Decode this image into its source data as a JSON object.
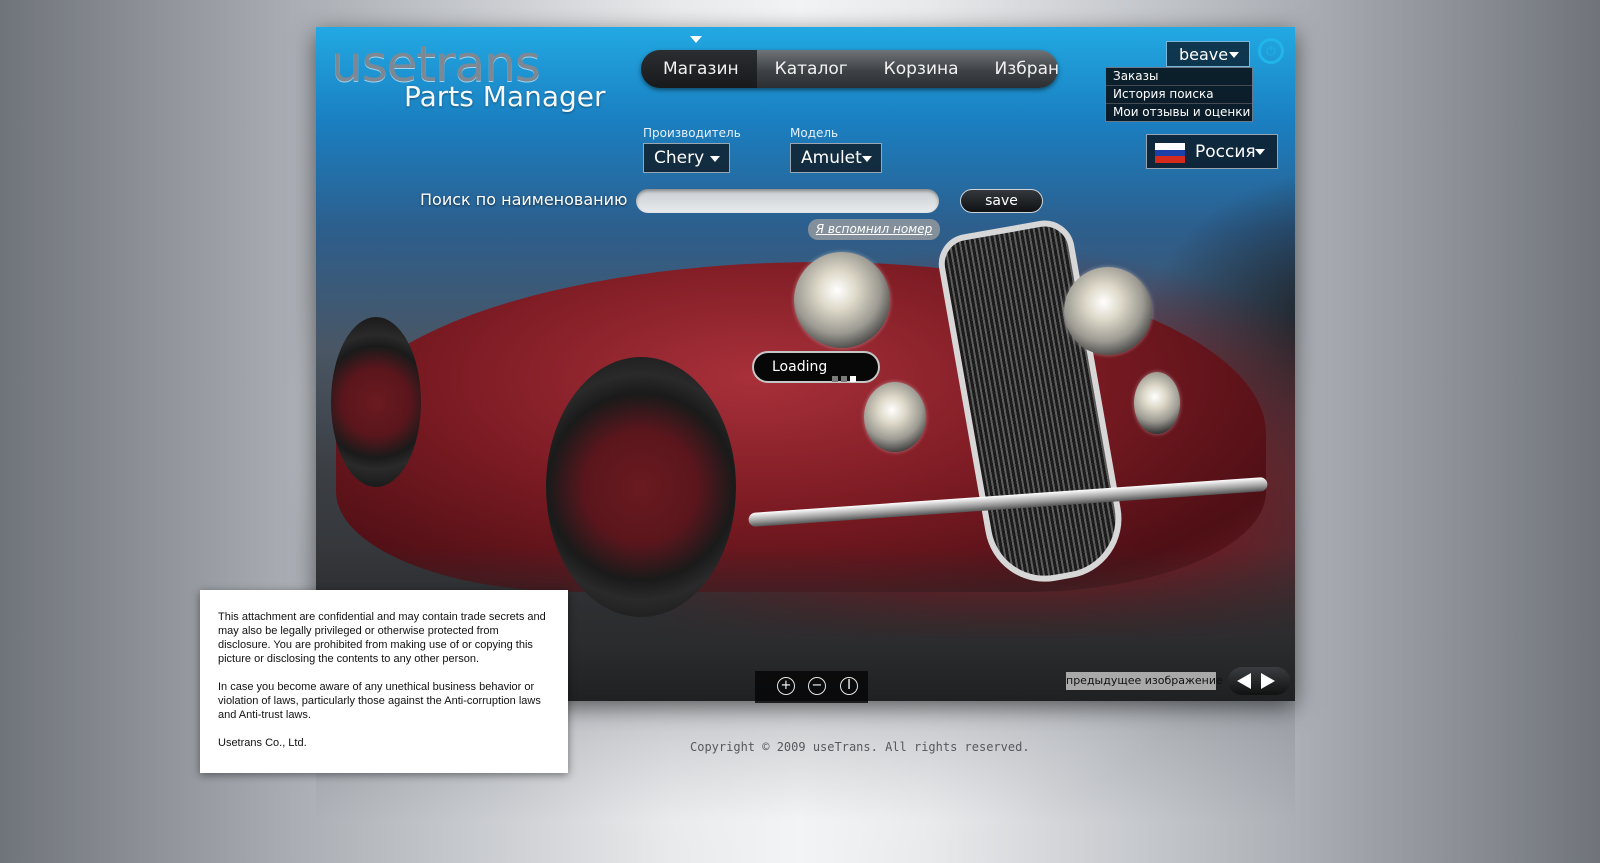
{
  "logo": {
    "brand": "usetrans",
    "subtitle": "Parts Manager"
  },
  "nav": {
    "tabs": [
      "Магазин",
      "Каталог",
      "Корзина",
      "Избранное"
    ],
    "active_index": 0
  },
  "user": {
    "name": "beave",
    "menu": [
      "Заказы",
      "История поиска",
      "Мои отзывы и оценки"
    ]
  },
  "country": {
    "label": "Россия",
    "flag_colors": [
      "#ffffff",
      "#1c3fa8",
      "#d52b1e"
    ]
  },
  "filters": {
    "manufacturer_label": "Производитель",
    "manufacturer_value": "Chery",
    "model_label": "Модель",
    "model_value": "Amulet"
  },
  "search": {
    "label": "Поиск по наименованию",
    "value": "",
    "save_label": "save",
    "remember_link": "Я вспомнил номер"
  },
  "loading": {
    "label": "Loading"
  },
  "zoom": {
    "icons": [
      "zoom-in-icon",
      "zoom-out-icon",
      "info-icon"
    ]
  },
  "gallery": {
    "prev_label": "предыдущее изображение"
  },
  "footer": {
    "copyright": "Copyright © 2009 useTrans. All rights reserved."
  },
  "disclaimer": {
    "p1": "This attachment are confidential and may contain trade secrets and may also be legally privileged or otherwise protected from disclosure. You are prohibited from making use of or copying this picture or disclosing the contents to any other person.",
    "p2": "In case you become aware of any unethical business behavior or violation of laws, particularly those against the Anti-corruption laws and Anti-trust laws.",
    "p3": "Usetrans Co., Ltd."
  },
  "colors": {
    "accent": "#22b5ea",
    "car": "#7a1a22"
  }
}
